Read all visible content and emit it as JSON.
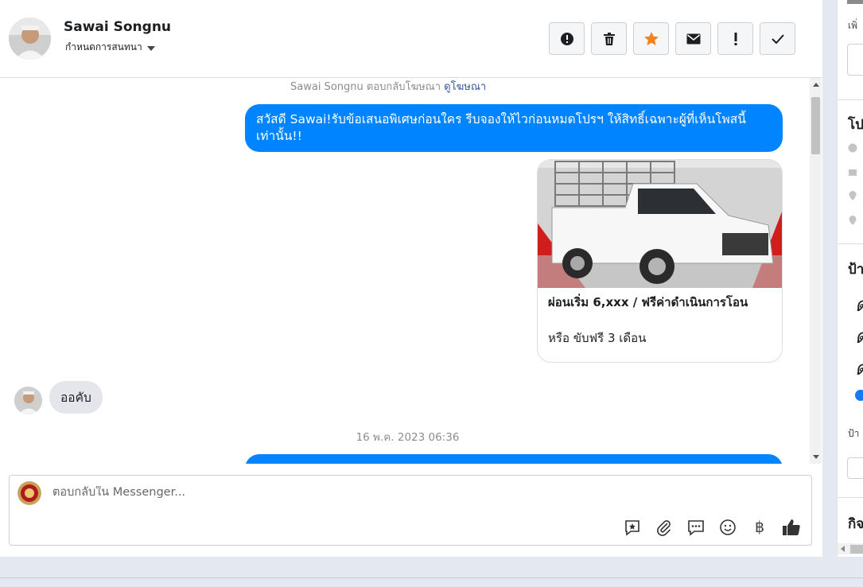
{
  "header": {
    "name": "Sawai Songnu",
    "subtitle": "กำหนดการสนทนา"
  },
  "actions": [
    {
      "name": "report-button",
      "icon": "alert-circle-icon"
    },
    {
      "name": "delete-button",
      "icon": "trash-icon"
    },
    {
      "name": "star-button",
      "icon": "star-icon",
      "color": "#f5821f"
    },
    {
      "name": "mark-unread-button",
      "icon": "envelope-icon"
    },
    {
      "name": "flag-button",
      "icon": "exclamation-icon"
    },
    {
      "name": "mark-done-button",
      "icon": "check-icon"
    }
  ],
  "thread": {
    "replied_note": "Sawai Songnu ตอบกลับโฆษณา",
    "replied_link": "ดูโฆษณา",
    "outgoing_message": "สวัสดี Sawai!รับข้อเสนอพิเศษก่อนใคร รีบจองให้ไวก่อนหมดโปรฯ ให้สิทธิ์เฉพาะผู้ที่เห็นโพสนี้เท่านั้น!!",
    "card": {
      "title": "ผ่อนเริ่ม 6,xxx / ฟรีค่าดำเนินการโอน",
      "subtitle": "หรือ ขับฟรี 3 เดือน"
    },
    "incoming_message": "ออคับ",
    "timestamp": "16 พ.ค. 2023 06:36"
  },
  "composer": {
    "placeholder": "ตอบกลับใน Messenger...",
    "currency_symbol": "฿"
  },
  "colors": {
    "accent": "#0084ff",
    "incoming_bubble": "#e4e6eb"
  },
  "side_panel": {
    "label_top": "เพิ่",
    "heading_1": "โป",
    "heading_2": "ป้า",
    "letter_a": "ด",
    "label_mid": "ป้า",
    "heading_3": "กิจ"
  }
}
